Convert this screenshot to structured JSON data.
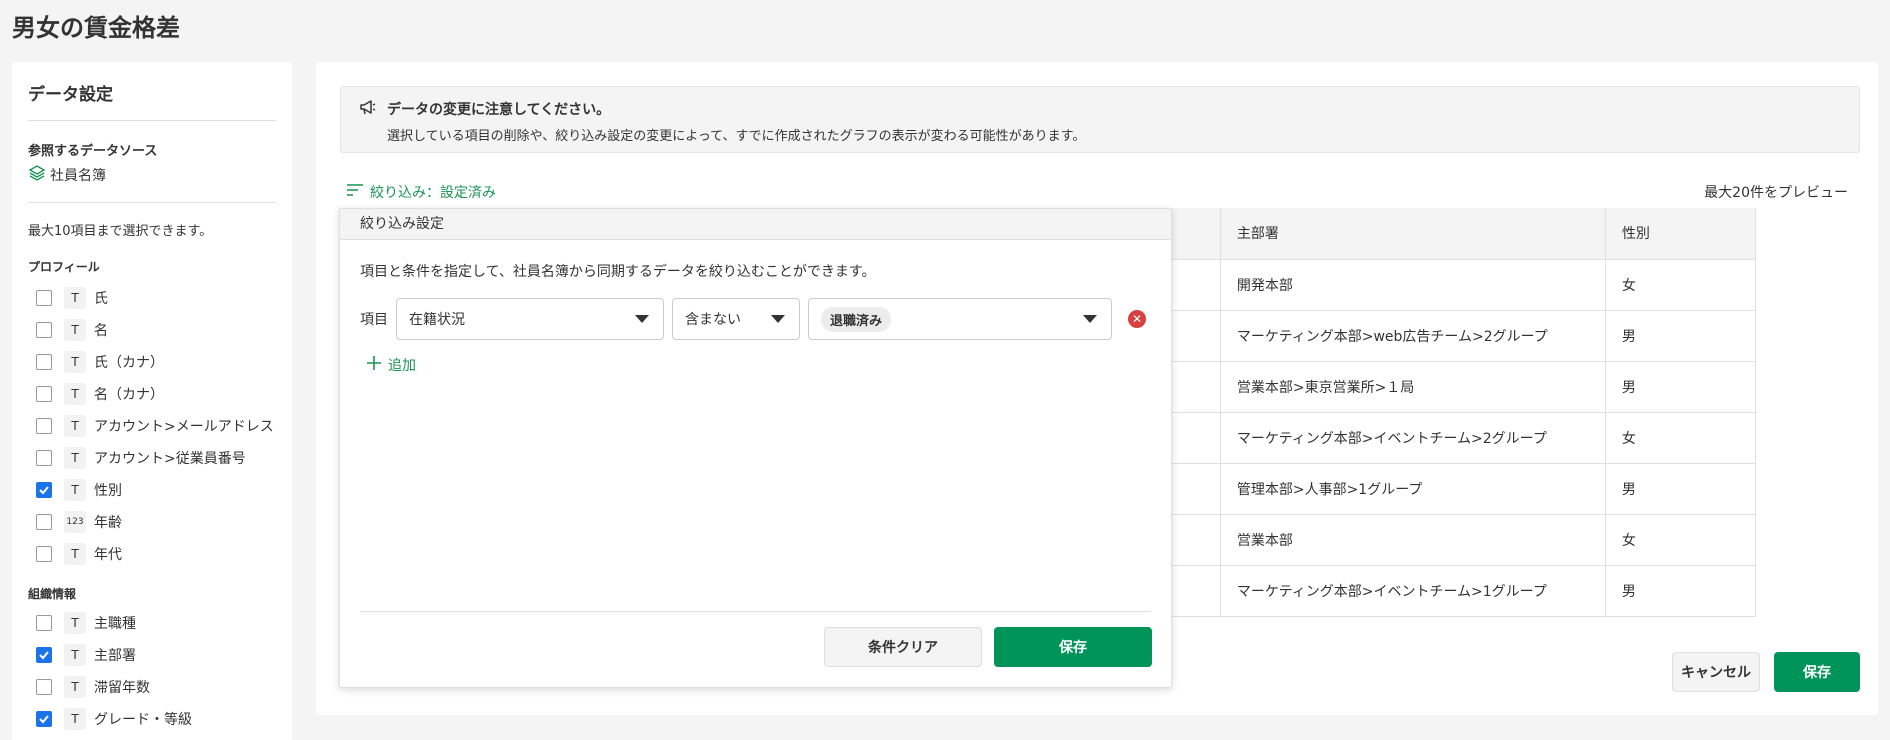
{
  "page": {
    "title": "男女の賃金格差"
  },
  "sidebar": {
    "title": "データ設定",
    "datasource_label": "参照するデータソース",
    "datasource_name": "社員名簿",
    "limit_note": "最大10項目まで選択できます。",
    "sections": [
      {
        "title": "プロフィール",
        "fields": [
          {
            "label": "氏",
            "type": "T",
            "checked": false
          },
          {
            "label": "名",
            "type": "T",
            "checked": false
          },
          {
            "label": "氏（カナ）",
            "type": "T",
            "checked": false
          },
          {
            "label": "名（カナ）",
            "type": "T",
            "checked": false
          },
          {
            "label": "アカウント>メールアドレス",
            "type": "T",
            "checked": false
          },
          {
            "label": "アカウント>従業員番号",
            "type": "T",
            "checked": false
          },
          {
            "label": "性別",
            "type": "T",
            "checked": true
          },
          {
            "label": "年齢",
            "type": "123",
            "checked": false
          },
          {
            "label": "年代",
            "type": "T",
            "checked": false
          }
        ]
      },
      {
        "title": "組織情報",
        "fields": [
          {
            "label": "主職種",
            "type": "T",
            "checked": false
          },
          {
            "label": "主部署",
            "type": "T",
            "checked": true
          },
          {
            "label": "滞留年数",
            "type": "T",
            "checked": false
          },
          {
            "label": "グレード・等級",
            "type": "T",
            "checked": true
          }
        ]
      }
    ]
  },
  "notice": {
    "title": "データの変更に注意してください。",
    "body": "選択している項目の削除や、絞り込み設定の変更によって、すでに作成されたグラフの表示が変わる可能性があります。"
  },
  "filter_toggle": {
    "label": "絞り込み：設定済み"
  },
  "preview_note": "最大20件をプレビュー",
  "table": {
    "headers": {
      "dept": "主部署",
      "sex": "性別"
    },
    "rows": [
      {
        "dept": "開発本部",
        "sex": "女"
      },
      {
        "dept": "マーケティング本部>web広告チーム>2グループ",
        "sex": "男"
      },
      {
        "dept": "営業本部>東京営業所>１局",
        "sex": "男"
      },
      {
        "dept": "マーケティング本部>イベントチーム>2グループ",
        "sex": "女"
      },
      {
        "dept": "管理本部>人事部>1グループ",
        "sex": "男"
      },
      {
        "dept": "営業本部",
        "sex": "女"
      },
      {
        "dept": "マーケティング本部>イベントチーム>1グループ",
        "sex": "男"
      }
    ]
  },
  "popup": {
    "header": "絞り込み設定",
    "description": "項目と条件を指定して、社員名簿から同期するデータを絞り込むことができます。",
    "row_label": "項目",
    "field_select": "在籍状況",
    "condition_select": "含まない",
    "value_chip": "退職済み",
    "add_label": "追加",
    "clear_label": "条件クリア",
    "save_label": "保存"
  },
  "footer": {
    "cancel_label": "キャンセル",
    "save_label": "保存"
  },
  "colors": {
    "accent": "#00945a",
    "link": "#1a9354",
    "checkbox": "#1a73e8",
    "remove": "#d94141"
  }
}
